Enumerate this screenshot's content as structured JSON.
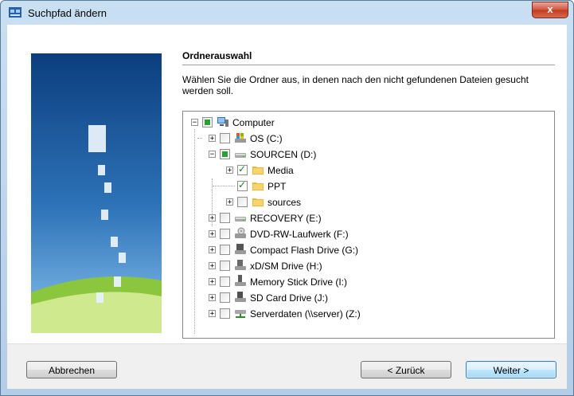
{
  "window": {
    "title": "Suchpfad ändern",
    "close_label": "x"
  },
  "section": {
    "title": "Ordnerauswahl",
    "description": "Wählen Sie die Ordner aus, in denen nach den nicht gefundenen Dateien gesucht werden soll."
  },
  "tree": {
    "root": {
      "label": "Computer",
      "icon": "computer-icon",
      "expander": "−",
      "check": "partial"
    },
    "drives": [
      {
        "label": "OS (C:)",
        "icon": "drive-os-icon",
        "expander": "+",
        "check": "unchecked"
      },
      {
        "label": "SOURCEN (D:)",
        "icon": "drive-icon",
        "expander": "−",
        "check": "partial"
      },
      {
        "label": "RECOVERY (E:)",
        "icon": "drive-icon",
        "expander": "+",
        "check": "unchecked"
      },
      {
        "label": "DVD-RW-Laufwerk (F:)",
        "icon": "dvd-drive-icon",
        "expander": "+",
        "check": "unchecked"
      },
      {
        "label": "Compact Flash Drive (G:)",
        "icon": "card-reader-icon",
        "expander": "+",
        "check": "unchecked"
      },
      {
        "label": "xD/SM Drive (H:)",
        "icon": "card-reader-icon",
        "expander": "+",
        "check": "unchecked"
      },
      {
        "label": "Memory Stick Drive (I:)",
        "icon": "card-reader-icon",
        "expander": "+",
        "check": "unchecked"
      },
      {
        "label": "SD Card Drive (J:)",
        "icon": "card-reader-icon",
        "expander": "+",
        "check": "unchecked"
      },
      {
        "label": "Serverdaten (\\\\server) (Z:)",
        "icon": "network-drive-icon",
        "expander": "+",
        "check": "unchecked"
      }
    ],
    "folders": [
      {
        "label": "Media",
        "icon": "folder-icon",
        "expander": "+",
        "check": "checked"
      },
      {
        "label": "PPT",
        "icon": "folder-icon",
        "expander": "",
        "check": "checked"
      },
      {
        "label": "sources",
        "icon": "folder-icon",
        "expander": "+",
        "check": "unchecked"
      }
    ]
  },
  "buttons": {
    "cancel": "Abbrechen",
    "back": "< Zurück",
    "next": "Weiter >"
  },
  "colors": {
    "accent": "#3c7fb1",
    "checked": "#1b7a22",
    "partial": "#2ba032"
  }
}
